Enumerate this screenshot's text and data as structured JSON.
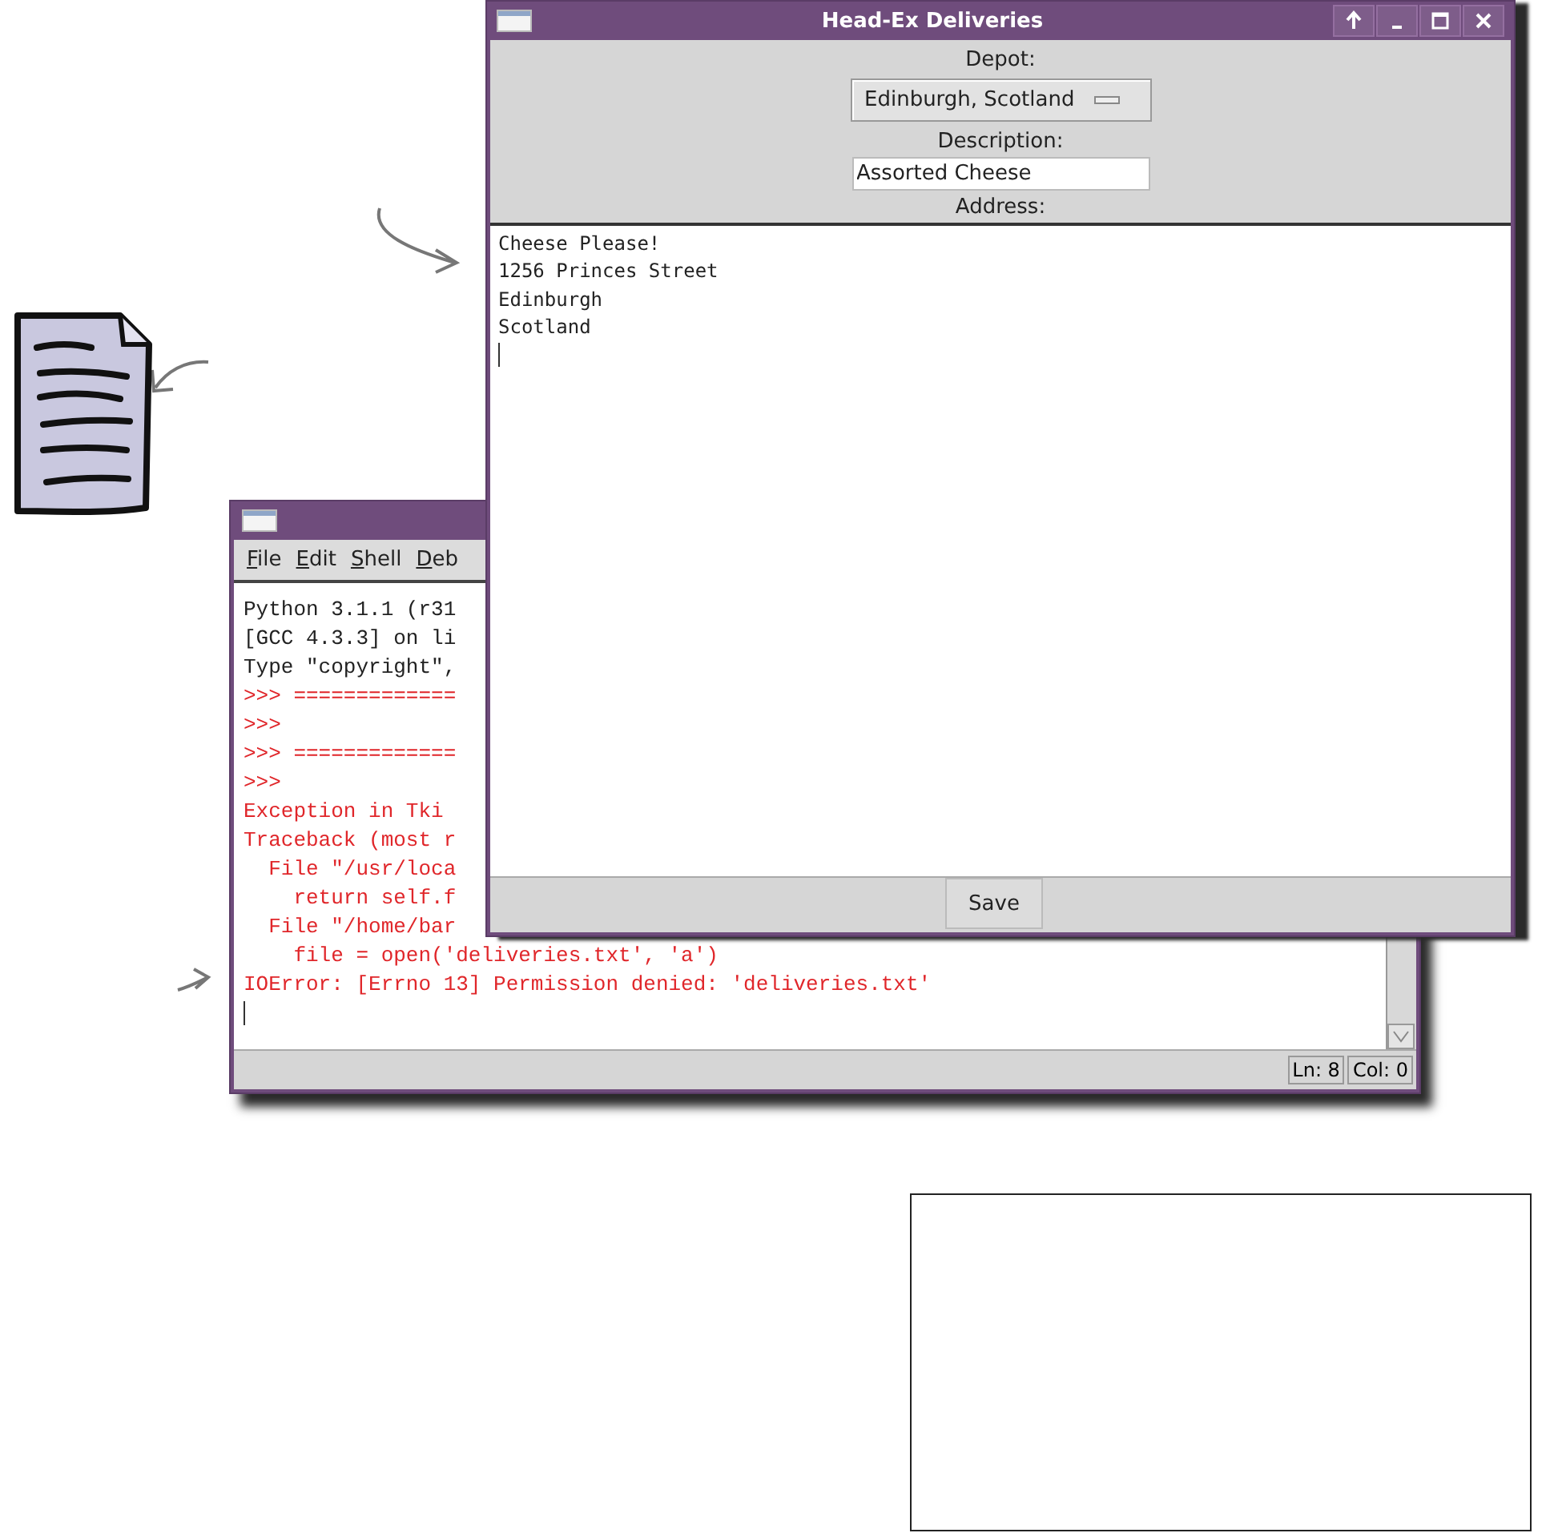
{
  "shell_window": {
    "menu": [
      {
        "label": "File"
      },
      {
        "label": "Edit"
      },
      {
        "label": "Shell"
      },
      {
        "label": "Deb"
      }
    ],
    "lines": [
      {
        "text": "Python 3.1.1 (r31",
        "kind": "output"
      },
      {
        "text": "[GCC 4.3.3] on li",
        "kind": "output"
      },
      {
        "text": "Type \"copyright\",",
        "kind": "output"
      },
      {
        "text": ">>> =============",
        "kind": "error"
      },
      {
        "text": ">>>",
        "kind": "error"
      },
      {
        "text": ">>> =============",
        "kind": "error"
      },
      {
        "text": ">>>",
        "kind": "error"
      },
      {
        "text": "Exception in Tki",
        "kind": "error"
      },
      {
        "text": "Traceback (most r",
        "kind": "error"
      },
      {
        "text": "  File \"/usr/loca",
        "kind": "error"
      },
      {
        "text": "    return self.f",
        "kind": "error"
      },
      {
        "text": "  File \"/home/bar",
        "kind": "error"
      },
      {
        "text": "    file = open('deliveries.txt', 'a')",
        "kind": "error"
      },
      {
        "text": "IOError: [Errno 13] Permission denied: 'deliveries.txt'",
        "kind": "error"
      }
    ],
    "status": [
      "Ln: 8",
      "Col: 0"
    ]
  },
  "deliveries_window": {
    "title": "Head-Ex Deliveries",
    "depot_label": "Depot:",
    "depot_value": "Edinburgh, Scotland",
    "description_label": "Description:",
    "description_value": "Assorted Cheese",
    "address_label": "Address:",
    "address_lines": [
      "Cheese Please!",
      "1256 Princes Street",
      "Edinburgh",
      "Scotland"
    ],
    "save_button": "Save"
  }
}
